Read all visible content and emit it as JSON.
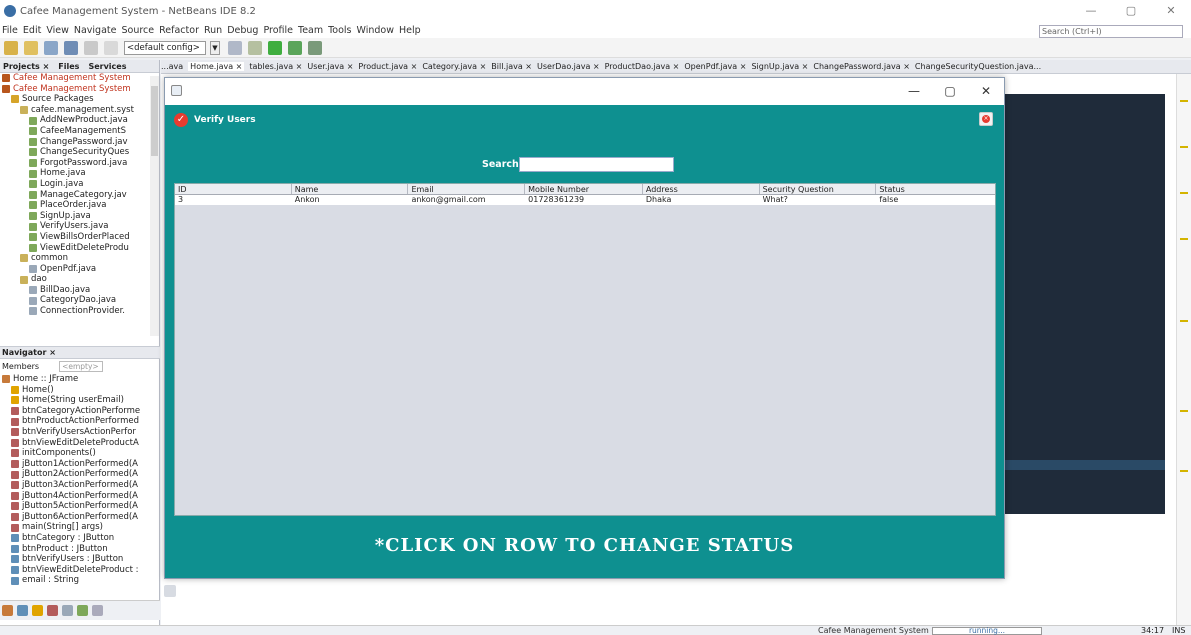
{
  "window": {
    "title": "Cafee Management System - NetBeans IDE 8.2",
    "minimize": "—",
    "maximize": "▢",
    "close": "✕"
  },
  "menu": [
    "File",
    "Edit",
    "View",
    "Navigate",
    "Source",
    "Refactor",
    "Run",
    "Debug",
    "Profile",
    "Team",
    "Tools",
    "Window",
    "Help"
  ],
  "ide_search": {
    "placeholder": "Search (Ctrl+I)"
  },
  "toolbar": {
    "config": "<default config>"
  },
  "panel_tabs": [
    "Projects ×",
    "Files",
    "Services"
  ],
  "project_tree": [
    {
      "label": "Cafee Management System",
      "indent": 0,
      "red": true,
      "color": "#b8561d"
    },
    {
      "label": "Cafee Management System",
      "indent": 0,
      "red": true,
      "color": "#b8561d"
    },
    {
      "label": "Source Packages",
      "indent": 1,
      "red": false,
      "color": "#d6a429"
    },
    {
      "label": "cafee.management.syst",
      "indent": 2,
      "red": false,
      "color": "#c9b15a"
    },
    {
      "label": "AddNewProduct.java",
      "indent": 3,
      "red": false,
      "color": "#7ea85a"
    },
    {
      "label": "CafeeManagementS",
      "indent": 3,
      "red": false,
      "color": "#7ea85a"
    },
    {
      "label": "ChangePassword.jav",
      "indent": 3,
      "red": false,
      "color": "#7ea85a"
    },
    {
      "label": "ChangeSecurityQues",
      "indent": 3,
      "red": false,
      "color": "#7ea85a"
    },
    {
      "label": "ForgotPassword.java",
      "indent": 3,
      "red": false,
      "color": "#7ea85a"
    },
    {
      "label": "Home.java",
      "indent": 3,
      "red": false,
      "color": "#7ea85a"
    },
    {
      "label": "Login.java",
      "indent": 3,
      "red": false,
      "color": "#7ea85a"
    },
    {
      "label": "ManageCategory.jav",
      "indent": 3,
      "red": false,
      "color": "#7ea85a"
    },
    {
      "label": "PlaceOrder.java",
      "indent": 3,
      "red": false,
      "color": "#7ea85a"
    },
    {
      "label": "SignUp.java",
      "indent": 3,
      "red": false,
      "color": "#7ea85a"
    },
    {
      "label": "VerifyUsers.java",
      "indent": 3,
      "red": false,
      "color": "#7ea85a"
    },
    {
      "label": "ViewBillsOrderPlaced",
      "indent": 3,
      "red": false,
      "color": "#7ea85a"
    },
    {
      "label": "ViewEditDeleteProdu",
      "indent": 3,
      "red": false,
      "color": "#7ea85a"
    },
    {
      "label": "common",
      "indent": 2,
      "red": false,
      "color": "#c9b15a"
    },
    {
      "label": "OpenPdf.java",
      "indent": 3,
      "red": false,
      "color": "#9aa8b8"
    },
    {
      "label": "dao",
      "indent": 2,
      "red": false,
      "color": "#c9b15a"
    },
    {
      "label": "BillDao.java",
      "indent": 3,
      "red": false,
      "color": "#9aa8b8"
    },
    {
      "label": "CategoryDao.java",
      "indent": 3,
      "red": false,
      "color": "#9aa8b8"
    },
    {
      "label": "ConnectionProvider.",
      "indent": 3,
      "red": false,
      "color": "#9aa8b8"
    }
  ],
  "navigator": {
    "title": "Navigator ×",
    "members_label": "Members",
    "filter_placeholder": "<empty>",
    "items": [
      {
        "label": "Home :: JFrame",
        "indent": 0,
        "color": "#c77a3a"
      },
      {
        "label": "Home()",
        "indent": 1,
        "color": "#e0a400"
      },
      {
        "label": "Home(String userEmail)",
        "indent": 1,
        "color": "#e0a400"
      },
      {
        "label": "btnCategoryActionPerforme",
        "indent": 1,
        "color": "#b35c5c"
      },
      {
        "label": "btnProductActionPerformed",
        "indent": 1,
        "color": "#b35c5c"
      },
      {
        "label": "btnVerifyUsersActionPerfor",
        "indent": 1,
        "color": "#b35c5c"
      },
      {
        "label": "btnViewEditDeleteProductA",
        "indent": 1,
        "color": "#b35c5c"
      },
      {
        "label": "initComponents()",
        "indent": 1,
        "color": "#b35c5c"
      },
      {
        "label": "jButton1ActionPerformed(A",
        "indent": 1,
        "color": "#b35c5c"
      },
      {
        "label": "jButton2ActionPerformed(A",
        "indent": 1,
        "color": "#b35c5c"
      },
      {
        "label": "jButton3ActionPerformed(A",
        "indent": 1,
        "color": "#b35c5c"
      },
      {
        "label": "jButton4ActionPerformed(A",
        "indent": 1,
        "color": "#b35c5c"
      },
      {
        "label": "jButton5ActionPerformed(A",
        "indent": 1,
        "color": "#b35c5c"
      },
      {
        "label": "jButton6ActionPerformed(A",
        "indent": 1,
        "color": "#b35c5c"
      },
      {
        "label": "main(String[] args)",
        "indent": 1,
        "color": "#b35c5c"
      },
      {
        "label": "btnCategory : JButton",
        "indent": 1,
        "color": "#5f8fb8"
      },
      {
        "label": "btnProduct : JButton",
        "indent": 1,
        "color": "#5f8fb8"
      },
      {
        "label": "btnVerifyUsers : JButton",
        "indent": 1,
        "color": "#5f8fb8"
      },
      {
        "label": "btnViewEditDeleteProduct :",
        "indent": 1,
        "color": "#5f8fb8"
      },
      {
        "label": "email : String",
        "indent": 1,
        "color": "#5f8fb8"
      }
    ]
  },
  "editor_tabs": [
    {
      "label": "...ava",
      "active": false
    },
    {
      "label": "Home.java ×",
      "active": true
    },
    {
      "label": "tables.java ×",
      "active": false
    },
    {
      "label": "User.java ×",
      "active": false
    },
    {
      "label": "Product.java ×",
      "active": false
    },
    {
      "label": "Category.java ×",
      "active": false
    },
    {
      "label": "Bill.java ×",
      "active": false
    },
    {
      "label": "UserDao.java ×",
      "active": false
    },
    {
      "label": "ProductDao.java ×",
      "active": false
    },
    {
      "label": "OpenPdf.java ×",
      "active": false
    },
    {
      "label": "SignUp.java ×",
      "active": false
    },
    {
      "label": "ChangePassword.java ×",
      "active": false
    },
    {
      "label": "ChangeSecurityQuestion.java...",
      "active": false
    }
  ],
  "dialog": {
    "heading": "Verify Users",
    "search_label": "Search",
    "search_value": "",
    "columns": [
      "ID",
      "Name",
      "Email",
      "Mobile Number",
      "Address",
      "Security Question",
      "Status"
    ],
    "rows": [
      [
        "3",
        "Ankon",
        "ankon@gmail.com",
        "01728361239",
        "Dhaka",
        "What?",
        "false"
      ]
    ],
    "footer_message": "*CLICK ON ROW TO CHANGE STATUS",
    "accent": "#0e9090"
  },
  "statusbar": {
    "task": "Cafee Management System (run)",
    "progress": "running...",
    "position": "34:17",
    "mode": "INS"
  }
}
